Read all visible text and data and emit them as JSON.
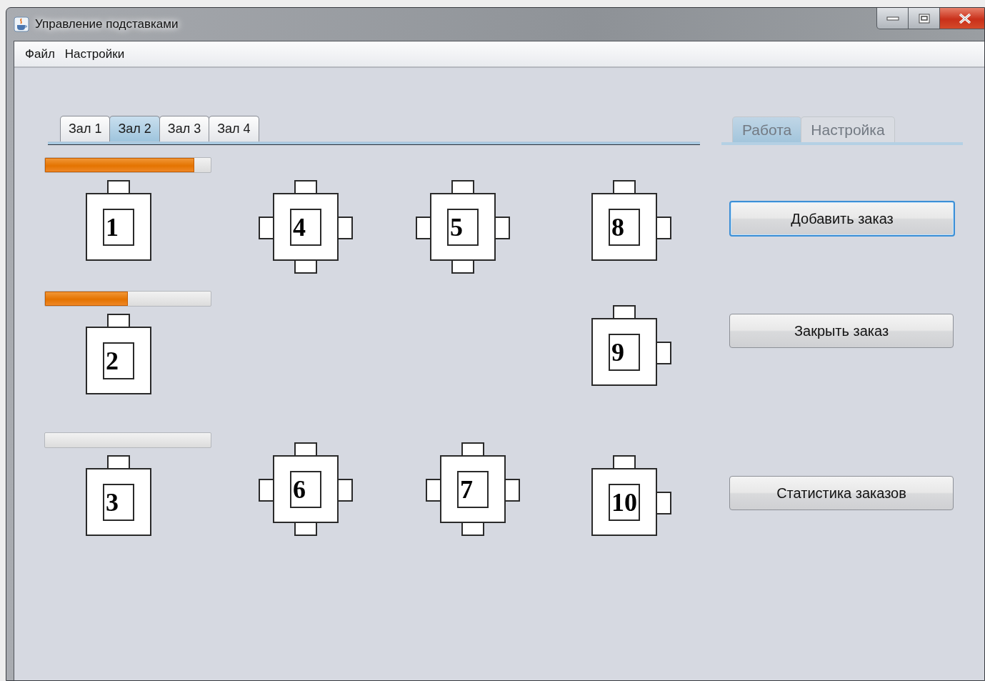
{
  "window": {
    "title": "Управление подставками"
  },
  "menu": [
    {
      "label": "Файл"
    },
    {
      "label": "Настройки"
    }
  ],
  "hall_tabs": [
    {
      "label": "Зал 1",
      "selected": false
    },
    {
      "label": "Зал 2",
      "selected": true
    },
    {
      "label": "Зал 3",
      "selected": false
    },
    {
      "label": "Зал 4",
      "selected": false
    }
  ],
  "tables": [
    {
      "number": "1",
      "kind": "single",
      "progress_bar": true,
      "level": 0.9
    },
    {
      "number": "4",
      "kind": "four"
    },
    {
      "number": "5",
      "kind": "four"
    },
    {
      "number": "8",
      "kind": "corner"
    },
    {
      "number": "2",
      "kind": "single",
      "progress_bar": true,
      "level": 0.5
    },
    {
      "number": "9",
      "kind": "corner"
    },
    {
      "number": "3",
      "kind": "single",
      "progress_bar": true
    },
    {
      "number": "6",
      "kind": "four"
    },
    {
      "number": "7",
      "kind": "four"
    },
    {
      "number": "10",
      "kind": "corner"
    }
  ],
  "mode_tabs": {
    "disabled": true,
    "items": [
      {
        "label": "Работа",
        "selected": true
      },
      {
        "label": "Настройка",
        "selected": false
      }
    ]
  },
  "buttons": [
    {
      "label": "Добавить заказ",
      "focused": true
    },
    {
      "label": "Закрыть заказ",
      "focused": false
    },
    {
      "label": "Статистика заказов",
      "focused": false
    }
  ]
}
